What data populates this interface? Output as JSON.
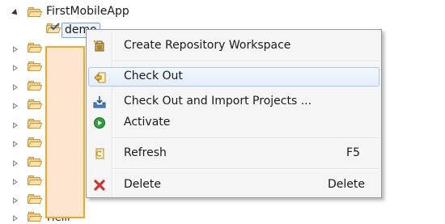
{
  "tree": {
    "root_label": "FirstMobileApp",
    "selected_label": "demo",
    "partial_label": "Helli"
  },
  "menu": {
    "items": [
      {
        "label": "Create Repository Workspace",
        "shortcut": "",
        "icon": "repository-icon"
      },
      {
        "label": "Check Out",
        "shortcut": "",
        "icon": "check-out-icon"
      },
      {
        "label": "Check Out and Import Projects ...",
        "shortcut": "",
        "icon": "import-projects-icon"
      },
      {
        "label": "Activate",
        "shortcut": "",
        "icon": "activate-icon"
      },
      {
        "label": "Refresh",
        "shortcut": "F5",
        "icon": "refresh-icon"
      },
      {
        "label": "Delete",
        "shortcut": "Delete",
        "icon": "delete-icon"
      }
    ]
  },
  "colors": {
    "highlight_fill": "#fde5cf",
    "highlight_border": "#f5a623",
    "menu_bg": "#f5f5f5",
    "hover_border": "#a8c8ec",
    "activate_green": "#2e9e3e",
    "delete_red": "#d0342c"
  }
}
